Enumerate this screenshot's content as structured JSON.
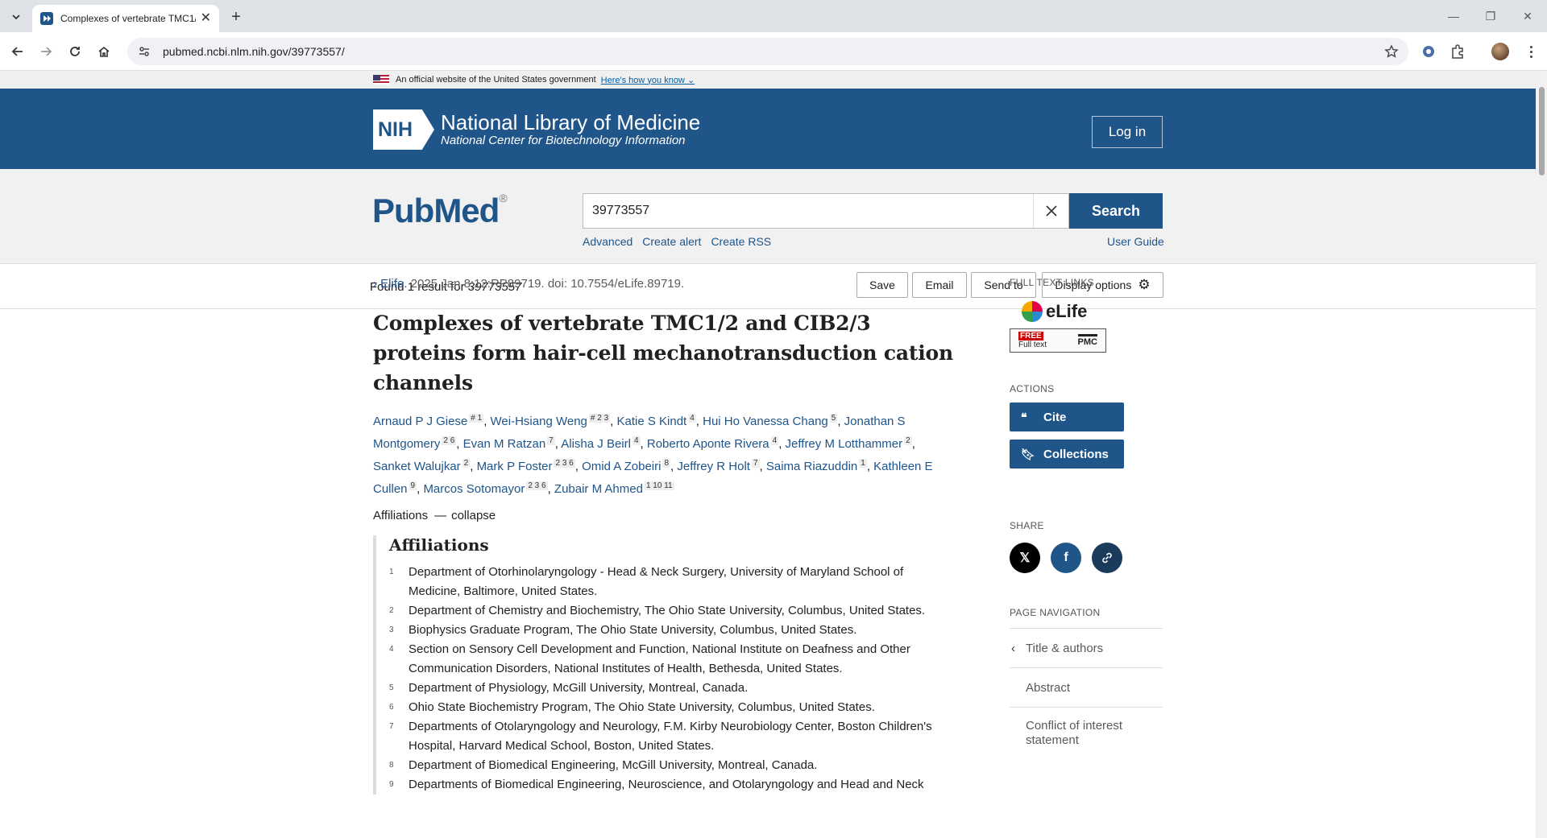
{
  "browser": {
    "tab_title": "Complexes of vertebrate TMC1/",
    "url": "pubmed.ncbi.nlm.nih.gov/39773557/"
  },
  "gov_banner": {
    "text": "An official website of the United States government",
    "link": "Here's how you know"
  },
  "header": {
    "logo_abbr": "NIH",
    "org_name": "National Library of Medicine",
    "org_sub": "National Center for Biotechnology Information",
    "login": "Log in"
  },
  "search": {
    "logo": "PubMed",
    "logo_mark": "®",
    "query": "39773557",
    "button": "Search",
    "links": [
      "Advanced",
      "Create alert",
      "Create RSS"
    ],
    "user_guide": "User Guide"
  },
  "results": {
    "found_prefix": "Found 1 result for",
    "found_term": "39773557",
    "save": "Save",
    "email": "Email",
    "send_to": "Send to",
    "display_options": "Display options"
  },
  "article": {
    "journal": "Elife.",
    "citation": "2025 Jan 8;12:RP89719. doi: 10.7554/eLife.89719.",
    "title": "Complexes of vertebrate TMC1/2 and CIB2/3 proteins form hair-cell mechanotransduction cation channels",
    "authors": [
      {
        "name": "Arnaud P J Giese",
        "sup": "# 1"
      },
      {
        "name": "Wei-Hsiang Weng",
        "sup": "# 2 3"
      },
      {
        "name": "Katie S Kindt",
        "sup": "4"
      },
      {
        "name": "Hui Ho Vanessa Chang",
        "sup": "5"
      },
      {
        "name": "Jonathan S Montgomery",
        "sup": "2 6"
      },
      {
        "name": "Evan M Ratzan",
        "sup": "7"
      },
      {
        "name": "Alisha J Beirl",
        "sup": "4"
      },
      {
        "name": "Roberto Aponte Rivera",
        "sup": "4"
      },
      {
        "name": "Jeffrey M Lotthammer",
        "sup": "2"
      },
      {
        "name": "Sanket Walujkar",
        "sup": "2"
      },
      {
        "name": "Mark P Foster",
        "sup": "2 3 6"
      },
      {
        "name": "Omid A Zobeiri",
        "sup": "8"
      },
      {
        "name": "Jeffrey R Holt",
        "sup": "7"
      },
      {
        "name": "Saima Riazuddin",
        "sup": "1"
      },
      {
        "name": "Kathleen E Cullen",
        "sup": "9"
      },
      {
        "name": "Marcos Sotomayor",
        "sup": "2 3 6"
      },
      {
        "name": "Zubair M Ahmed",
        "sup": "1 10 11"
      }
    ],
    "affiliations_label": "Affiliations",
    "collapse_label": "collapse",
    "affiliations_heading": "Affiliations",
    "affiliations": [
      {
        "num": "1",
        "text": "Department of Otorhinolaryngology - Head & Neck Surgery, University of Maryland School of Medicine, Baltimore, United States."
      },
      {
        "num": "2",
        "text": "Department of Chemistry and Biochemistry, The Ohio State University, Columbus, United States."
      },
      {
        "num": "3",
        "text": "Biophysics Graduate Program, The Ohio State University, Columbus, United States."
      },
      {
        "num": "4",
        "text": "Section on Sensory Cell Development and Function, National Institute on Deafness and Other Communication Disorders, National Institutes of Health, Bethesda, United States."
      },
      {
        "num": "5",
        "text": "Department of Physiology, McGill University, Montreal, Canada."
      },
      {
        "num": "6",
        "text": "Ohio State Biochemistry Program, The Ohio State University, Columbus, United States."
      },
      {
        "num": "7",
        "text": "Departments of Otolaryngology and Neurology, F.M. Kirby Neurobiology Center, Boston Children's Hospital, Harvard Medical School, Boston, United States."
      },
      {
        "num": "8",
        "text": "Department of Biomedical Engineering, McGill University, Montreal, Canada."
      },
      {
        "num": "9",
        "text": "Departments of Biomedical Engineering, Neuroscience, and Otolaryngology and Head and Neck"
      }
    ]
  },
  "sidebar": {
    "full_text_label": "FULL TEXT LINKS",
    "elife": "eLife",
    "free_top": "FREE",
    "free_bottom": "Full text",
    "pmc": "PMC",
    "actions_label": "ACTIONS",
    "cite": "Cite",
    "collections": "Collections",
    "share_label": "SHARE",
    "page_nav_label": "PAGE NAVIGATION",
    "page_nav": [
      "Title & authors",
      "Abstract",
      "Conflict of interest statement"
    ]
  }
}
